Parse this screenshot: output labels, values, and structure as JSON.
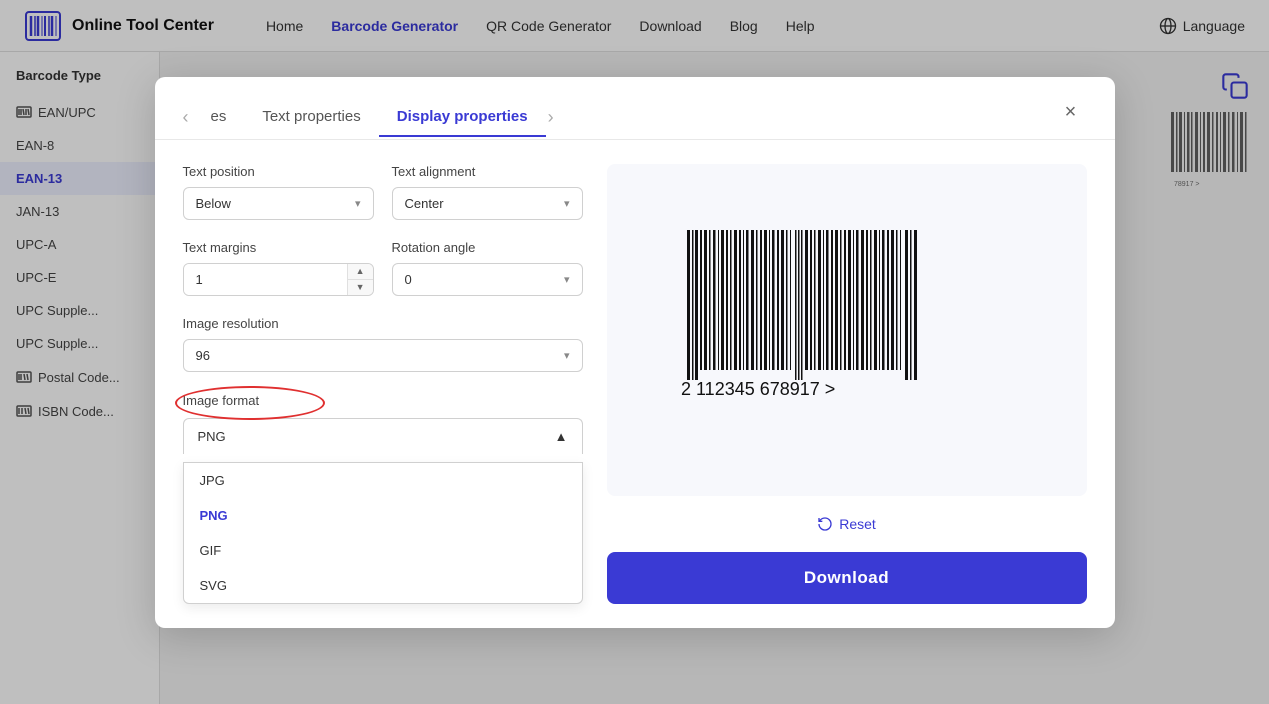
{
  "navbar": {
    "brand": "Online Tool Center",
    "links": [
      {
        "label": "Home",
        "active": false
      },
      {
        "label": "Barcode Generator",
        "active": true
      },
      {
        "label": "QR Code Generator",
        "active": false
      },
      {
        "label": "Download",
        "active": false
      },
      {
        "label": "Blog",
        "active": false
      },
      {
        "label": "Help",
        "active": false
      }
    ],
    "language_label": "Language"
  },
  "sidebar": {
    "title": "Barcode Type",
    "items": [
      {
        "label": "EAN/UPC",
        "has_icon": true,
        "active": false
      },
      {
        "label": "EAN-8",
        "has_icon": false,
        "active": false
      },
      {
        "label": "EAN-13",
        "has_icon": false,
        "active": true
      },
      {
        "label": "JAN-13",
        "has_icon": false,
        "active": false
      },
      {
        "label": "UPC-A",
        "has_icon": false,
        "active": false
      },
      {
        "label": "UPC-E",
        "has_icon": false,
        "active": false
      },
      {
        "label": "UPC Supple...",
        "has_icon": false,
        "active": false
      },
      {
        "label": "UPC Supple...",
        "has_icon": false,
        "active": false
      },
      {
        "label": "Postal Code...",
        "has_icon": true,
        "active": false
      },
      {
        "label": "ISBN Code...",
        "has_icon": true,
        "active": false
      }
    ]
  },
  "modal": {
    "tabs": [
      {
        "label": "es",
        "active": false
      },
      {
        "label": "Text properties",
        "active": false
      },
      {
        "label": "Display properties",
        "active": true
      }
    ],
    "close_label": "×",
    "form": {
      "text_position_label": "Text position",
      "text_position_value": "Below",
      "text_alignment_label": "Text alignment",
      "text_alignment_value": "Center",
      "text_margins_label": "Text margins",
      "text_margins_value": "1",
      "rotation_angle_label": "Rotation angle",
      "rotation_angle_value": "0",
      "image_resolution_label": "Image resolution",
      "image_resolution_value": "96",
      "image_format_label": "Image format",
      "image_format_value": "PNG",
      "format_options": [
        {
          "label": "JPG",
          "selected": false
        },
        {
          "label": "PNG",
          "selected": true
        },
        {
          "label": "GIF",
          "selected": false
        },
        {
          "label": "SVG",
          "selected": false
        }
      ]
    },
    "reset_label": "Reset",
    "download_label": "Download",
    "barcode_number": "2  112345  678917  >"
  }
}
